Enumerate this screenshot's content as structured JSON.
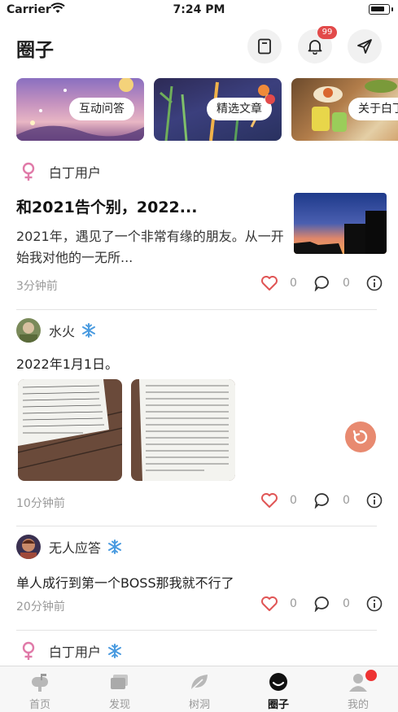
{
  "status": {
    "carrier": "Carrier",
    "time": "7:24 PM"
  },
  "header": {
    "title": "圈子",
    "notification_badge": "99"
  },
  "tiles": [
    {
      "label": "互动问答"
    },
    {
      "label": "精选文章"
    },
    {
      "label": "关于白丁"
    }
  ],
  "posts": [
    {
      "user": "白丁用户",
      "title": "和2021告个别，2022...",
      "excerpt": "2021年，遇见了一个非常有缘的朋友。从一开始我对他的一无所...",
      "time": "3分钟前",
      "likes": "0",
      "comments": "0"
    },
    {
      "user": "水火",
      "text": "2022年1月1日。",
      "time": "10分钟前",
      "likes": "0",
      "comments": "0"
    },
    {
      "user": "无人应答",
      "text": "单人成行到第一个BOSS那我就不行了",
      "time": "20分钟前",
      "likes": "0",
      "comments": "0"
    },
    {
      "user": "白丁用户"
    }
  ],
  "tabbar": [
    {
      "label": "首页"
    },
    {
      "label": "发现"
    },
    {
      "label": "树洞"
    },
    {
      "label": "圈子"
    },
    {
      "label": "我的"
    }
  ],
  "colors": {
    "like": "#e05555",
    "female": "#e07aa8",
    "snow": "#4a9be0",
    "fab": "#e88a70",
    "badge": "#e24a4a"
  }
}
